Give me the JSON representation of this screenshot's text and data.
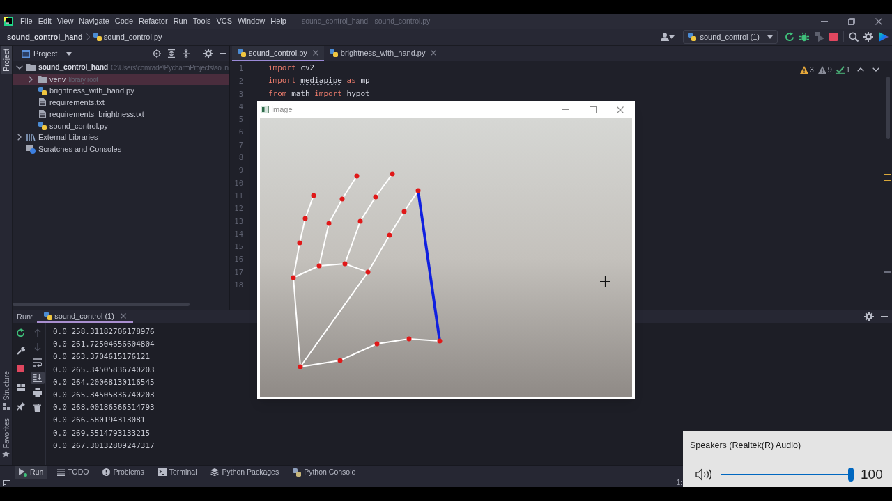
{
  "title_bar": {
    "menus": [
      "File",
      "Edit",
      "View",
      "Navigate",
      "Code",
      "Refactor",
      "Run",
      "Tools",
      "VCS",
      "Window",
      "Help"
    ],
    "title": "sound_control_hand - sound_control.py"
  },
  "nav_bar": {
    "breadcrumbs": [
      {
        "label": "sound_control_hand",
        "kind": "project"
      },
      {
        "label": "sound_control.py",
        "kind": "python"
      }
    ],
    "run_config": "sound_control (1)"
  },
  "tool_strip": {
    "top": [
      {
        "label": "Project",
        "selected": true
      }
    ],
    "bottom": [
      {
        "label": "Structure",
        "kind": "structure",
        "selected": false
      },
      {
        "label": "Favorites",
        "kind": "favorites",
        "selected": false
      }
    ]
  },
  "project_panel": {
    "title": "Project",
    "tree": [
      {
        "label": "sound_control_hand",
        "kind": "project",
        "note": "C:\\Users\\comrade\\PycharmProjects\\soun",
        "expanded": true,
        "selected": false,
        "children": [
          {
            "label": "venv",
            "kind": "folder",
            "note": "library root",
            "expanded": false,
            "selected": true
          },
          {
            "label": "brightness_with_hand.py",
            "kind": "python",
            "selected": false
          },
          {
            "label": "requirements.txt",
            "kind": "text",
            "selected": false
          },
          {
            "label": "requirements_brightness.txt",
            "kind": "text",
            "selected": false
          },
          {
            "label": "sound_control.py",
            "kind": "python",
            "selected": false
          }
        ]
      },
      {
        "label": "External Libraries",
        "kind": "library",
        "expanded": false,
        "selected": false
      },
      {
        "label": "Scratches and Consoles",
        "kind": "scratches",
        "selected": false
      }
    ]
  },
  "editor": {
    "tabs": [
      {
        "label": "sound_control.py",
        "selected": true
      },
      {
        "label": "brightness_with_hand.py",
        "selected": false
      }
    ],
    "inspections": [
      {
        "kind": "warning",
        "count": "3"
      },
      {
        "kind": "weak_warning",
        "count": "9"
      },
      {
        "kind": "typo",
        "count": "1"
      }
    ],
    "line_numbers": [
      "1",
      "2",
      "3",
      "4",
      "5",
      "6",
      "7",
      "8",
      "9",
      "10",
      "11",
      "12",
      "13",
      "14",
      "15",
      "16",
      "17",
      "18"
    ],
    "code": [
      [
        {
          "text": "import ",
          "kind": "keyword"
        },
        {
          "text": "cv2",
          "kind": "name",
          "underlined": true
        }
      ],
      [
        {
          "text": "import ",
          "kind": "keyword"
        },
        {
          "text": "mediapipe",
          "kind": "name",
          "underlined": true
        },
        {
          "text": " as ",
          "kind": "keyword"
        },
        {
          "text": "mp",
          "kind": "name"
        }
      ],
      [
        {
          "text": "from ",
          "kind": "keyword"
        },
        {
          "text": "math ",
          "kind": "name"
        },
        {
          "text": "import ",
          "kind": "keyword"
        },
        {
          "text": "hypot",
          "kind": "name"
        }
      ]
    ]
  },
  "image_window": {
    "title": "Image"
  },
  "run_panel": {
    "label": "Run:",
    "tab": "sound_control (1)",
    "scroll_to_end": true,
    "output": [
      "0.0 258.31182706178976",
      "0.0 261.72504656604804",
      "0.0 263.3704615176121",
      "0.0 265.34505836740203",
      "0.0 264.20068130116545",
      "0.0 265.34505836740203",
      "0.0 268.00186566514793",
      "0.0 266.580194313081",
      "0.0 269.5514793133215",
      "0.0 267.30132809247317"
    ]
  },
  "bottom_tabs": [
    {
      "label": "Run",
      "kind": "run",
      "selected": true
    },
    {
      "label": "TODO",
      "kind": "todo",
      "selected": false
    },
    {
      "label": "Problems",
      "kind": "problems",
      "selected": false
    },
    {
      "label": "Terminal",
      "kind": "terminal",
      "selected": false
    },
    {
      "label": "Python Packages",
      "kind": "packages",
      "selected": false
    },
    {
      "label": "Python Console",
      "kind": "console",
      "selected": false
    }
  ],
  "status_bar": {
    "position": "1:"
  },
  "volume_flyout": {
    "device": "Speakers (Realtek(R) Audio)",
    "level": 1,
    "reading": "100"
  }
}
